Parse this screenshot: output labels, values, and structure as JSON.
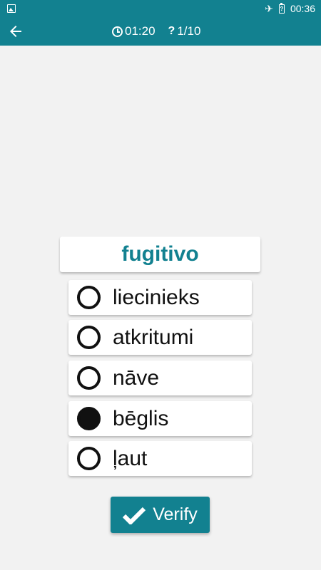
{
  "status_bar": {
    "time": "00:36",
    "battery_glyph": "?",
    "icons": [
      "gallery-icon",
      "airplane-icon",
      "battery-icon"
    ]
  },
  "toolbar": {
    "timer": "01:20",
    "progress": "1/10",
    "back_icon": "arrow-left-icon"
  },
  "question": {
    "word": "fugitivo"
  },
  "options": [
    {
      "label": "liecinieks",
      "selected": false
    },
    {
      "label": "atkritumi",
      "selected": false
    },
    {
      "label": "nāve",
      "selected": false
    },
    {
      "label": "bēglis",
      "selected": true
    },
    {
      "label": "ļaut",
      "selected": false
    }
  ],
  "verify": {
    "label": "Verify"
  },
  "colors": {
    "accent": "#128190",
    "background": "#f2f2f2"
  }
}
